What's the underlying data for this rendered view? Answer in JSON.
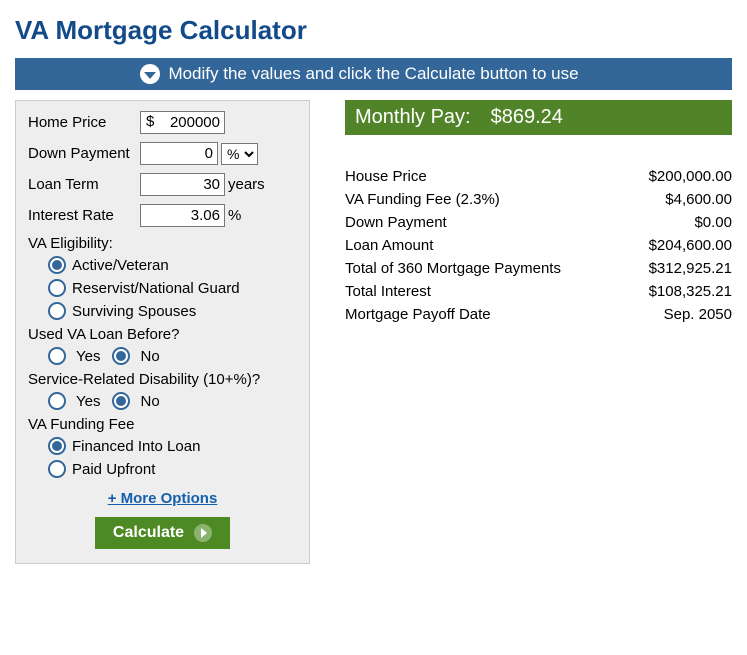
{
  "title": "VA Mortgage Calculator",
  "banner_text": "Modify the values and click the Calculate button to use",
  "form": {
    "home_price_label": "Home Price",
    "home_price_value": "200000",
    "down_payment_label": "Down Payment",
    "down_payment_value": "0",
    "down_payment_unit": "%",
    "loan_term_label": "Loan Term",
    "loan_term_value": "30",
    "loan_term_unit": "years",
    "interest_rate_label": "Interest Rate",
    "interest_rate_value": "3.06",
    "interest_rate_unit": "%",
    "eligibility_label": "VA Eligibility:",
    "eligibility_options": [
      "Active/Veteran",
      "Reservist/National Guard",
      "Surviving Spouses"
    ],
    "used_before_label": "Used VA Loan Before?",
    "yes": "Yes",
    "no": "No",
    "disability_label": "Service-Related Disability (10+%)?",
    "funding_fee_label": "VA Funding Fee",
    "funding_fee_options": [
      "Financed Into Loan",
      "Paid Upfront"
    ],
    "more_options": "+ More Options",
    "calculate": "Calculate"
  },
  "results": {
    "monthly_label": "Monthly Pay:",
    "monthly_value": "$869.24",
    "rows": [
      {
        "label": "House Price",
        "value": "$200,000.00"
      },
      {
        "label": "VA Funding Fee (2.3%)",
        "value": "$4,600.00"
      },
      {
        "label": "Down Payment",
        "value": "$0.00"
      },
      {
        "label": "Loan Amount",
        "value": "$204,600.00"
      },
      {
        "label": "Total of 360 Mortgage Payments",
        "value": "$312,925.21"
      },
      {
        "label": "Total Interest",
        "value": "$108,325.21"
      },
      {
        "label": "Mortgage Payoff Date",
        "value": "Sep. 2050"
      }
    ]
  }
}
